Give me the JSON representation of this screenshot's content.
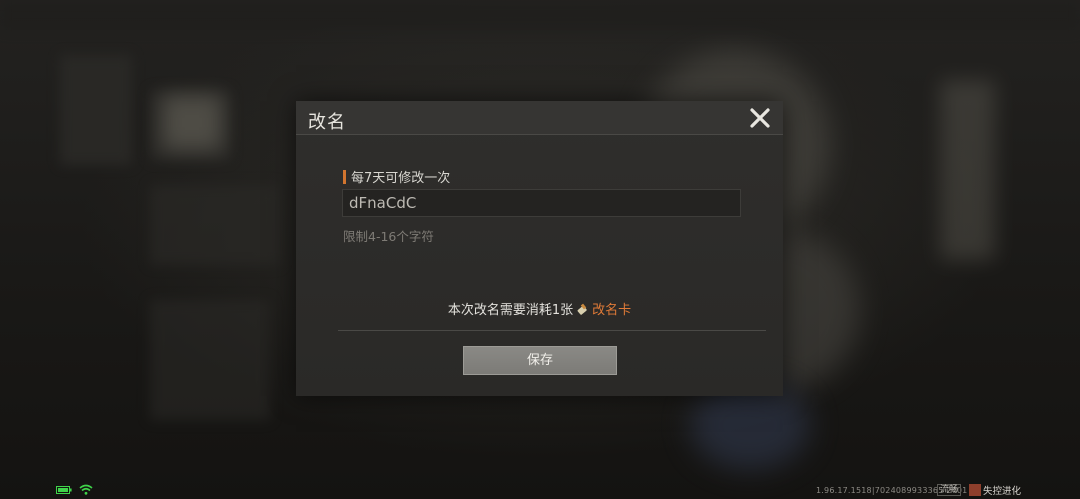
{
  "dialog": {
    "title": "改名",
    "hint": "每7天可修改一次",
    "name_value": "dFnaCdC",
    "limit": "限制4-16个字符",
    "cost_prefix": "本次改名需要消耗1张",
    "cost_item": "改名卡",
    "save_label": "保存",
    "accent_color": "#d2752f",
    "item_color": "#e07a37"
  },
  "statusbar": {
    "version": "1.96.17.1518|7024089933365 2401",
    "quality": "流畅",
    "logo_text": "失控进化",
    "battery_icon": "battery-icon",
    "wifi_icon": "wifi-icon"
  }
}
